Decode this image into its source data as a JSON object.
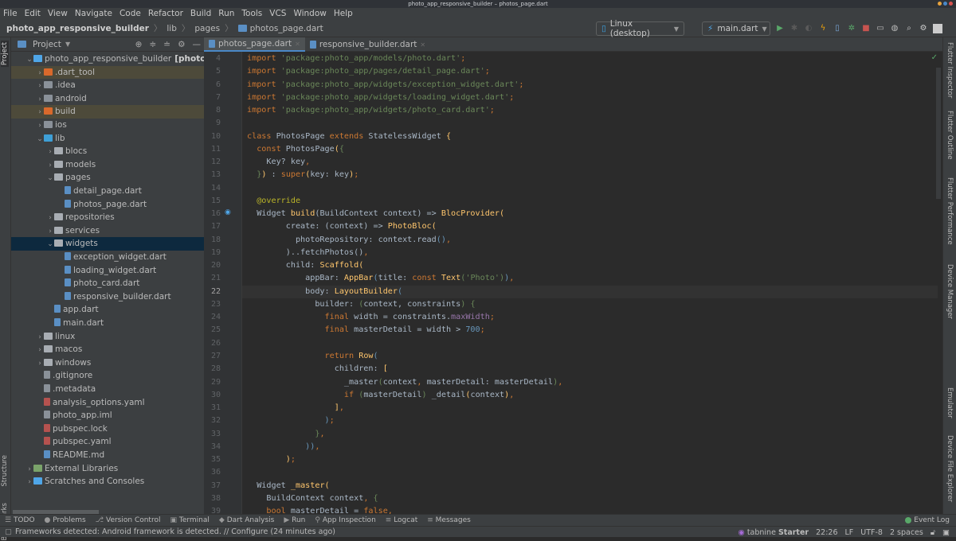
{
  "window": {
    "title": "photo_app_responsive_builder – photos_page.dart"
  },
  "menu": [
    "File",
    "Edit",
    "View",
    "Navigate",
    "Code",
    "Refactor",
    "Build",
    "Run",
    "Tools",
    "VCS",
    "Window",
    "Help"
  ],
  "breadcrumb": [
    "photo_app_responsive_builder",
    "lib",
    "pages",
    "photos_page.dart"
  ],
  "toolbar": {
    "device": "Linux (desktop)",
    "run_config": "main.dart"
  },
  "project_panel": {
    "title": "Project"
  },
  "left_strip": {
    "project": "Project",
    "structure": "Structure",
    "bookmarks": "Bookmarks"
  },
  "tree": [
    {
      "label": "photo_app_responsive_builder",
      "suffix": "[photo_app]",
      "depth": 0,
      "chev": "v",
      "icon": "flutter-project",
      "type": "root"
    },
    {
      "label": ".dart_tool",
      "depth": 1,
      "chev": ">",
      "icon": "folder-orange",
      "state": "excluded"
    },
    {
      "label": ".idea",
      "depth": 1,
      "chev": ">",
      "icon": "folder-settings"
    },
    {
      "label": "android",
      "depth": 1,
      "chev": ">",
      "icon": "folder-module"
    },
    {
      "label": "build",
      "depth": 1,
      "chev": ">",
      "icon": "folder-excluded",
      "state": "excluded"
    },
    {
      "label": "ios",
      "depth": 1,
      "chev": ">",
      "icon": "folder-module"
    },
    {
      "label": "lib",
      "depth": 1,
      "chev": "v",
      "icon": "folder-source"
    },
    {
      "label": "blocs",
      "depth": 2,
      "chev": ">",
      "icon": "folder"
    },
    {
      "label": "models",
      "depth": 2,
      "chev": ">",
      "icon": "folder"
    },
    {
      "label": "pages",
      "depth": 2,
      "chev": "v",
      "icon": "folder"
    },
    {
      "label": "detail_page.dart",
      "depth": 3,
      "chev": "",
      "icon": "dart-file"
    },
    {
      "label": "photos_page.dart",
      "depth": 3,
      "chev": "",
      "icon": "dart-file"
    },
    {
      "label": "repositories",
      "depth": 2,
      "chev": ">",
      "icon": "folder"
    },
    {
      "label": "services",
      "depth": 2,
      "chev": ">",
      "icon": "folder"
    },
    {
      "label": "widgets",
      "depth": 2,
      "chev": "v",
      "icon": "folder",
      "state": "selected"
    },
    {
      "label": "exception_widget.dart",
      "depth": 3,
      "chev": "",
      "icon": "dart-file"
    },
    {
      "label": "loading_widget.dart",
      "depth": 3,
      "chev": "",
      "icon": "dart-file"
    },
    {
      "label": "photo_card.dart",
      "depth": 3,
      "chev": "",
      "icon": "dart-file"
    },
    {
      "label": "responsive_builder.dart",
      "depth": 3,
      "chev": "",
      "icon": "dart-file"
    },
    {
      "label": "app.dart",
      "depth": 2,
      "chev": "",
      "icon": "dart-file"
    },
    {
      "label": "main.dart",
      "depth": 2,
      "chev": "",
      "icon": "dart-file"
    },
    {
      "label": "linux",
      "depth": 1,
      "chev": ">",
      "icon": "folder"
    },
    {
      "label": "macos",
      "depth": 1,
      "chev": ">",
      "icon": "folder"
    },
    {
      "label": "windows",
      "depth": 1,
      "chev": ">",
      "icon": "folder"
    },
    {
      "label": ".gitignore",
      "depth": 1,
      "chev": "",
      "icon": "text-file"
    },
    {
      "label": ".metadata",
      "depth": 1,
      "chev": "",
      "icon": "text-file"
    },
    {
      "label": "analysis_options.yaml",
      "depth": 1,
      "chev": "",
      "icon": "yaml-file"
    },
    {
      "label": "photo_app.iml",
      "depth": 1,
      "chev": "",
      "icon": "iml-file"
    },
    {
      "label": "pubspec.lock",
      "depth": 1,
      "chev": "",
      "icon": "yaml-file"
    },
    {
      "label": "pubspec.yaml",
      "depth": 1,
      "chev": "",
      "icon": "yaml-file"
    },
    {
      "label": "README.md",
      "depth": 1,
      "chev": "",
      "icon": "markdown-file"
    },
    {
      "label": "External Libraries",
      "depth": 0,
      "chev": ">",
      "icon": "libraries"
    },
    {
      "label": "Scratches and Consoles",
      "depth": 0,
      "chev": ">",
      "icon": "scratches"
    }
  ],
  "tabs": [
    {
      "label": "photos_page.dart",
      "active": true
    },
    {
      "label": "responsive_builder.dart",
      "active": false
    }
  ],
  "editor": {
    "current_line": 22,
    "lines": [
      {
        "n": 4,
        "t": [
          [
            "kw",
            "import "
          ],
          [
            "str",
            "'package:photo_app/models/photo.dart'"
          ],
          [
            "kw",
            ";"
          ]
        ]
      },
      {
        "n": 5,
        "t": [
          [
            "kw",
            "import "
          ],
          [
            "str",
            "'package:photo_app/pages/detail_page.dart'"
          ],
          [
            "kw",
            ";"
          ]
        ]
      },
      {
        "n": 6,
        "t": [
          [
            "kw",
            "import "
          ],
          [
            "str",
            "'package:photo_app/widgets/exception_widget.dart'"
          ],
          [
            "kw",
            ";"
          ]
        ]
      },
      {
        "n": 7,
        "t": [
          [
            "kw",
            "import "
          ],
          [
            "str",
            "'package:photo_app/widgets/loading_widget.dart'"
          ],
          [
            "kw",
            ";"
          ]
        ]
      },
      {
        "n": 8,
        "t": [
          [
            "kw",
            "import "
          ],
          [
            "str",
            "'package:photo_app/widgets/photo_card.dart'"
          ],
          [
            "kw",
            ";"
          ]
        ]
      },
      {
        "n": 9,
        "t": []
      },
      {
        "n": 10,
        "t": [
          [
            "kw",
            "class "
          ],
          [
            "p",
            "PhotosPage "
          ],
          [
            "kw",
            "extends "
          ],
          [
            "p",
            "StatelessWidget "
          ],
          [
            "fn",
            "{"
          ]
        ]
      },
      {
        "n": 11,
        "t": [
          [
            "p",
            "  "
          ],
          [
            "kw",
            "const "
          ],
          [
            "p",
            "PhotosPage"
          ],
          [
            "fn",
            "("
          ],
          [
            "str",
            "{"
          ]
        ]
      },
      {
        "n": 12,
        "t": [
          [
            "p",
            "    Key? key"
          ],
          [
            "kw",
            ","
          ]
        ]
      },
      {
        "n": 13,
        "t": [
          [
            "p",
            "  "
          ],
          [
            "str",
            "}"
          ],
          [
            "fn",
            ")"
          ],
          [
            "p",
            " : "
          ],
          [
            "kw",
            "super"
          ],
          [
            "fn",
            "("
          ],
          [
            "p",
            "key: key"
          ],
          [
            "fn",
            ")"
          ],
          [
            "kw",
            ";"
          ]
        ]
      },
      {
        "n": 14,
        "t": []
      },
      {
        "n": 15,
        "t": [
          [
            "p",
            "  "
          ],
          [
            "ann",
            "@override"
          ]
        ]
      },
      {
        "n": 16,
        "t": [
          [
            "p",
            "  Widget "
          ],
          [
            "fn",
            "build"
          ],
          [
            "p",
            "(BuildContext context) => "
          ],
          [
            "fn",
            "BlocProvider("
          ]
        ]
      },
      {
        "n": 17,
        "t": [
          [
            "p",
            "        create: (context) => "
          ],
          [
            "fn",
            "PhotoBloc("
          ]
        ]
      },
      {
        "n": 18,
        "t": [
          [
            "p",
            "          photoRepository: context.read"
          ],
          [
            "num",
            "()"
          ],
          [
            "kw",
            ","
          ]
        ]
      },
      {
        "n": 19,
        "t": [
          [
            "p",
            "        )..fetchPhotos()"
          ],
          [
            "kw",
            ","
          ]
        ]
      },
      {
        "n": 20,
        "t": [
          [
            "p",
            "        child: "
          ],
          [
            "fn",
            "Scaffold("
          ]
        ]
      },
      {
        "n": 21,
        "t": [
          [
            "p",
            "            appBar: "
          ],
          [
            "fn",
            "AppBar"
          ],
          [
            "num",
            "("
          ],
          [
            "p",
            "title: "
          ],
          [
            "kw",
            "const "
          ],
          [
            "fn",
            "Text"
          ],
          [
            "str",
            "("
          ],
          [
            "str",
            "'Photo'"
          ],
          [
            "str",
            ")"
          ],
          [
            "num",
            ")"
          ],
          [
            "kw",
            ","
          ]
        ]
      },
      {
        "n": 22,
        "t": [
          [
            "p",
            "            body: "
          ],
          [
            "fn",
            "LayoutBuilder"
          ],
          [
            "num",
            "("
          ]
        ]
      },
      {
        "n": 23,
        "t": [
          [
            "p",
            "              builder: "
          ],
          [
            "str",
            "("
          ],
          [
            "p",
            "context, constraints"
          ],
          [
            "str",
            ")"
          ],
          [
            "p",
            " "
          ],
          [
            "str",
            "{"
          ]
        ]
      },
      {
        "n": 24,
        "t": [
          [
            "p",
            "                "
          ],
          [
            "kw",
            "final "
          ],
          [
            "p",
            "width = constraints."
          ],
          [
            "prop",
            "maxWidth"
          ],
          [
            "kw",
            ";"
          ]
        ]
      },
      {
        "n": 25,
        "t": [
          [
            "p",
            "                "
          ],
          [
            "kw",
            "final "
          ],
          [
            "p",
            "masterDetail = width > "
          ],
          [
            "num",
            "700"
          ],
          [
            "kw",
            ";"
          ]
        ]
      },
      {
        "n": 26,
        "t": []
      },
      {
        "n": 27,
        "t": [
          [
            "p",
            "                "
          ],
          [
            "kw",
            "return "
          ],
          [
            "fn",
            "Row"
          ],
          [
            "num",
            "("
          ]
        ]
      },
      {
        "n": 28,
        "t": [
          [
            "p",
            "                  children: "
          ],
          [
            "fn",
            "["
          ]
        ]
      },
      {
        "n": 29,
        "t": [
          [
            "p",
            "                    _master"
          ],
          [
            "str",
            "("
          ],
          [
            "p",
            "context"
          ],
          [
            "kw",
            ", "
          ],
          [
            "p",
            "masterDetail: masterDetail"
          ],
          [
            "str",
            ")"
          ],
          [
            "kw",
            ","
          ]
        ]
      },
      {
        "n": 30,
        "t": [
          [
            "p",
            "                    "
          ],
          [
            "kw",
            "if "
          ],
          [
            "str",
            "("
          ],
          [
            "p",
            "masterDetail"
          ],
          [
            "str",
            ")"
          ],
          [
            "p",
            " _detail"
          ],
          [
            "fn",
            "("
          ],
          [
            "p",
            "context"
          ],
          [
            "fn",
            ")"
          ],
          [
            "kw",
            ","
          ]
        ]
      },
      {
        "n": 31,
        "t": [
          [
            "p",
            "                  "
          ],
          [
            "fn",
            "]"
          ],
          [
            "kw",
            ","
          ]
        ]
      },
      {
        "n": 32,
        "t": [
          [
            "p",
            "                "
          ],
          [
            "num",
            ")"
          ],
          [
            "kw",
            ";"
          ]
        ]
      },
      {
        "n": 33,
        "t": [
          [
            "p",
            "              "
          ],
          [
            "str",
            "}"
          ],
          [
            "kw",
            ","
          ]
        ]
      },
      {
        "n": 34,
        "t": [
          [
            "p",
            "            "
          ],
          [
            "num",
            "))"
          ],
          [
            "kw",
            ","
          ]
        ]
      },
      {
        "n": 35,
        "t": [
          [
            "p",
            "        "
          ],
          [
            "fn",
            ")"
          ],
          [
            "kw",
            ";"
          ]
        ]
      },
      {
        "n": 36,
        "t": []
      },
      {
        "n": 37,
        "t": [
          [
            "p",
            "  Widget "
          ],
          [
            "fn",
            "_master("
          ]
        ]
      },
      {
        "n": 38,
        "t": [
          [
            "p",
            "    BuildContext context"
          ],
          [
            "kw",
            ", "
          ],
          [
            "str",
            "{"
          ]
        ]
      },
      {
        "n": 39,
        "t": [
          [
            "p",
            "    "
          ],
          [
            "kw",
            "bool "
          ],
          [
            "p",
            "masterDetail = "
          ],
          [
            "kw",
            "false"
          ],
          [
            "kw",
            ","
          ]
        ]
      }
    ]
  },
  "right_strip": [
    "Flutter Inspector",
    "Flutter Outline",
    "Flutter Performance",
    "Device Manager",
    "Emulator",
    "Device File Explorer"
  ],
  "bottom_tools": [
    "TODO",
    "Problems",
    "Version Control",
    "Terminal",
    "Dart Analysis",
    "Run",
    "App Inspection",
    "Logcat",
    "Messages"
  ],
  "event_log": "Event Log",
  "status": {
    "message": "Frameworks detected: Android framework is detected. // Configure (24 minutes ago)",
    "tabnine": "tabnine",
    "tabnine_plan": "Starter",
    "position": "22:26",
    "line_sep": "LF",
    "encoding": "UTF-8",
    "indent": "2 spaces"
  },
  "colors": {
    "accent": "#4a88c7",
    "selection": "#0d293e",
    "excluded": "#4d4a3a",
    "run": "#59a869",
    "stop": "#c75450"
  }
}
